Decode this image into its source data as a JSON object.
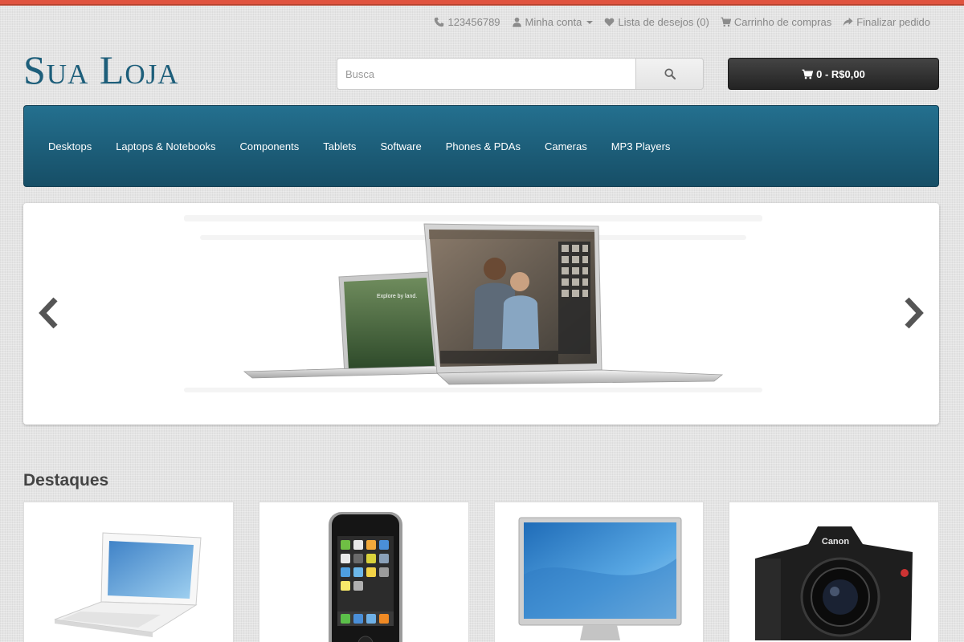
{
  "toplinks": {
    "phone": "123456789",
    "account": "Minha conta",
    "wishlist": "Lista de desejos (0)",
    "cart": "Carrinho de compras",
    "checkout": "Finalizar pedido"
  },
  "logo": "Sua Loja",
  "search": {
    "placeholder": "Busca"
  },
  "cart_button": "0 - R$0,00",
  "menu": [
    "Desktops",
    "Laptops & Notebooks",
    "Components",
    "Tablets",
    "Software",
    "Phones & PDAs",
    "Cameras",
    "MP3 Players"
  ],
  "slide": {
    "screen_text": "Explore by land."
  },
  "featured_heading": "Destaques",
  "camera_brand": "Canon",
  "icons": [
    "phone-icon",
    "user-icon",
    "heart-icon",
    "cart-icon",
    "share-icon",
    "search-icon",
    "chevron-left-icon",
    "chevron-right-icon"
  ],
  "colors": {
    "accent": "#1d5e7a",
    "menu": "#1d6480",
    "stripe": "#e0533f"
  }
}
